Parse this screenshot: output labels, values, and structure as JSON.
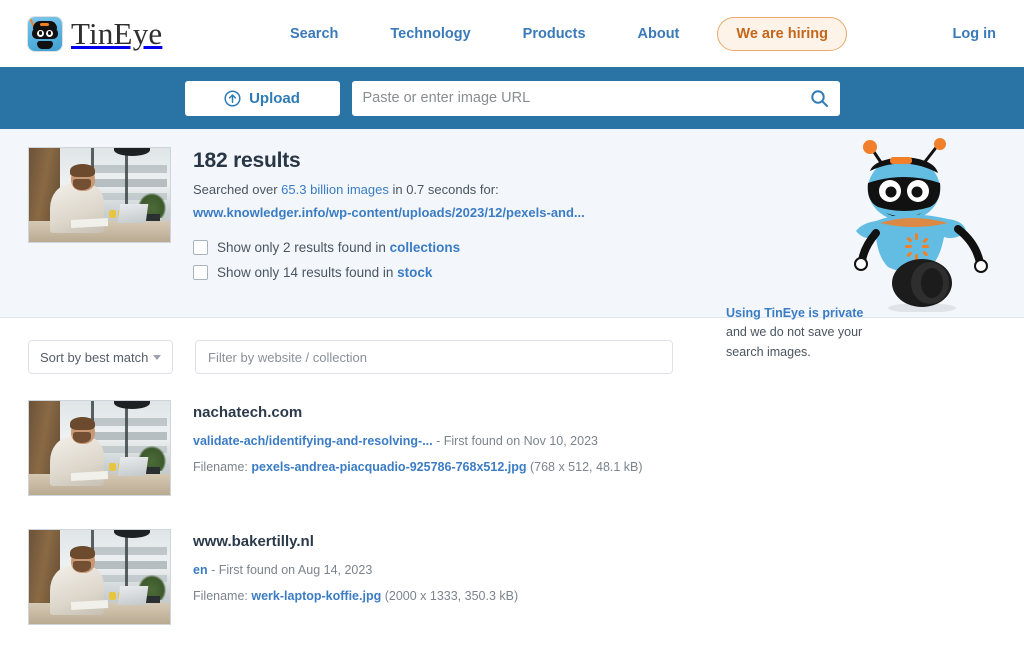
{
  "brand": {
    "name": "TinEye",
    "logo_icon": "tineye-robot-logo-icon"
  },
  "nav": {
    "links": [
      {
        "label": "Search"
      },
      {
        "label": "Technology"
      },
      {
        "label": "Products"
      },
      {
        "label": "About"
      }
    ],
    "hiring_label": "We are hiring",
    "login_label": "Log in"
  },
  "search": {
    "upload_label": "Upload",
    "upload_icon": "upload-circle-arrow-icon",
    "url_placeholder": "Paste or enter image URL",
    "url_value": "",
    "search_icon": "search-icon"
  },
  "summary": {
    "result_count": "182 results",
    "searched_prefix": "Searched over ",
    "searched_link": "65.3 billion images",
    "searched_suffix": " in 0.7 seconds for:",
    "source_url": "www.knowledger.info/wp-content/uploads/2023/12/pexels-and...",
    "checkboxes": [
      {
        "text": "Show only 2 results found in ",
        "link": "collections",
        "checked": false
      },
      {
        "text": "Show only 14 results found in ",
        "link": "stock",
        "checked": false
      }
    ],
    "privacy_link": "Using TinEye is private",
    "privacy_text": " and we do not save your search images.",
    "mascot_icon": "tineye-robot-mascot-icon"
  },
  "filters": {
    "sort_value": "Sort by best match",
    "sort_caret_icon": "chevron-down-icon",
    "filter_placeholder": "Filter by website / collection",
    "filter_value": ""
  },
  "results": [
    {
      "domain": "nachatech.com",
      "path_link": "validate-ach/identifying-and-resolving-...",
      "found_text": " - First found on Nov 10, 2023",
      "filename_label": "Filename: ",
      "filename_link": "pexels-andrea-piacquadio-925786-768x512.jpg",
      "file_meta": " (768 x 512, 48.1 kB)"
    },
    {
      "domain": "www.bakertilly.nl",
      "path_link": "en",
      "found_text": " - First found on Aug 14, 2023",
      "filename_label": "Filename: ",
      "filename_link": "werk-laptop-koffie.jpg",
      "file_meta": " (2000 x 1333, 350.3 kB)"
    }
  ],
  "colors": {
    "banner_blue": "#2a73a5",
    "link_blue": "#3b7cc4",
    "hiring_orange": "#c4661b",
    "panel_bg": "#f3f7fb"
  }
}
